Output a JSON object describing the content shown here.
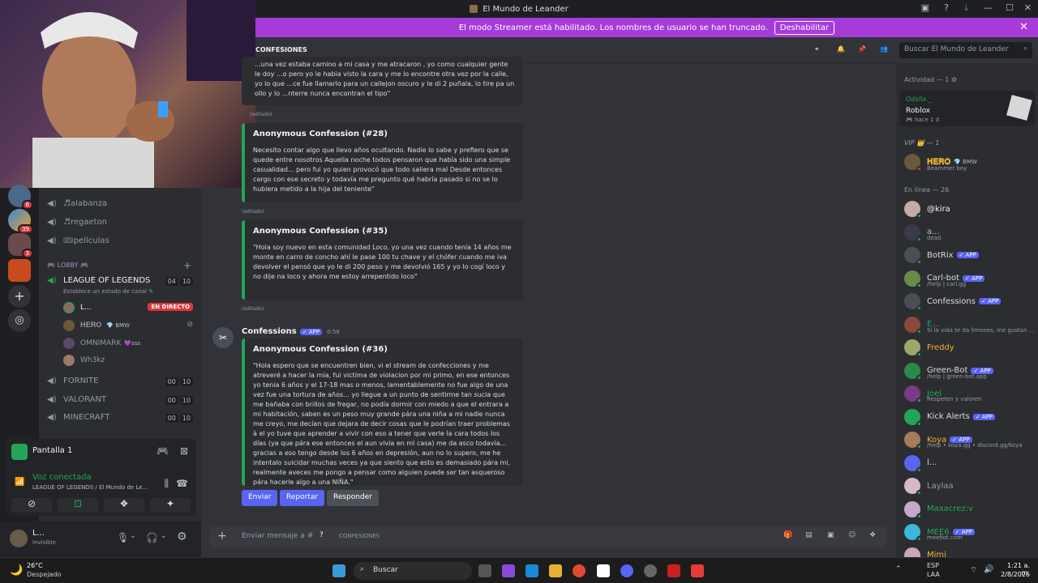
{
  "window": {
    "title": "El Mundo de Leander"
  },
  "banner": {
    "text": "El modo Streamer está habilitado. Los nombres de usuario se han truncado.",
    "button": "Deshabilitar"
  },
  "header": {
    "channel": "CONFESIONES",
    "search_placeholder": "Buscar El Mundo de Leander"
  },
  "channels": {
    "voice": [
      {
        "name": "♬alabanza"
      },
      {
        "name": "♬regaeton"
      },
      {
        "name": "🎟peliculas"
      }
    ],
    "category": "LOBBY",
    "lol": {
      "name": "LEAGUE OF LEGENDS",
      "status": "Establece un estado de canal",
      "count_a": "04",
      "count_b": "10"
    },
    "voice_users": [
      {
        "name": "L...",
        "live": "EN DIRECTO"
      },
      {
        "name": "𝐇𝐄𝐑𝐎",
        "tag": "BMW"
      },
      {
        "name": "OMNIMARK",
        "tag": "ꜱꜱꜱ"
      },
      {
        "name": "Wh3kz"
      }
    ],
    "others": [
      {
        "name": "FORNITE",
        "a": "00",
        "b": "10"
      },
      {
        "name": "VALORANT",
        "a": "00",
        "b": "10"
      },
      {
        "name": "MINECRAFT",
        "a": "00",
        "b": "10"
      }
    ]
  },
  "voice_panel": {
    "screen": "Pantalla 1",
    "status": "Voz conectada",
    "location": "LEAGUE OF LEGENDS / El Mundo de Le..."
  },
  "user_panel": {
    "name": "L...",
    "status": "Invisible"
  },
  "messages": {
    "top_embed_text": "...una vez estaba camino a mi casa y me atracaron , yo como cualquier gente le doy ...o pero yo le habia visto la cara y me lo encontre otra vez por la calle, yo lo que ...ce fue llamarlo para un callejon oscuro y le di 2 puñala, lo tire pa un ollo y lo ...nterre nunca encontran el tipo\"",
    "edit_label": "(editado)",
    "c28_title": "Anonymous Confession (#28)",
    "c28_text": "Necesito contar algo que llevo años ocultando. Nadie lo sabe y prefiero que se quede entre nosotros Aquella noche todos pensaron que había sido una simple casualidad... pero fui yo quien provocó que todo saliera mal Desde entonces cargo con ese secreto y todavía me pregunto qué habría pasado si no se lo hubiera metido a la hija del teniente\"",
    "c35_title": "Anonymous Confession (#35)",
    "c35_text": "\"Hola soy nuevo en esta comunidad Loco, yo una vez cuando tenía 14 años me monte en carro de concho ahí le pase 100 tu chave y el chófer cuando me iva devolver el pensó que yo le di 200 peso y me devolvió 165 y yo lo cogí loco y no dije na loco y ahora me estoy arrepentido loco\"",
    "author": "Confessions",
    "app_badge": "✓ APP",
    "time": "0:58",
    "c36_title": "Anonymous Confession (#36)",
    "c36_text": "\"Hola espero que se encuentren bien, vi el stream de confecciones y me atreveré a hacer la mia, fui victima de violacion por mi primo, en ese entonces yo tenia 6 años y el 17-18 mas o menos, lamentablemente no fue algo de una vez fue una tortura de años... yo llegue a un punto de sentirme tan sucia que me bañaba con brillos de fregar, no podía dormir con miedo a que el entrara a mi habitación, saben es un peso muy grande pára una niña a mi nadie nunca me creyo, me decían que dejara de decir cosas que le podrían traer problemas à el yo tuve que aprender a vivir con eso a tener que verle la cara todos los días (ya que pára ese entonces el aun vivia en mi casa) me da asco todavía... gracias a eso tengo desde los 6 años en depresión, aun no lo supero, me he intentalo suicidar muchas veces ya que siento que esto es demasiado pára mi, realmente aveces me pongo a pensar como alguien puede ser tan asqueroso pára hacerle algo a una NIÑA.\"",
    "actions": [
      "Enviar",
      "Reportar",
      "Responder"
    ]
  },
  "composer": {
    "placeholder": "Enviar mensaje a #",
    "channel": "CONFESIONES"
  },
  "members": {
    "activity_header": "Actividad — 1",
    "activity": {
      "user": "Odxlix._",
      "game": "Roblox",
      "time": "hace 1 d"
    },
    "vip_header": "VIP 👑 — 1",
    "vip": {
      "name": "𝐇𝐄𝐑𝐎",
      "tag": "BMW",
      "sub": "Beammer boy"
    },
    "online_header": "En línea — 26",
    "list": [
      {
        "name": "@kira",
        "sub": ""
      },
      {
        "name": "a...",
        "sub": "dead"
      },
      {
        "name": "BotRix",
        "app": "✓ APP",
        "sub": ""
      },
      {
        "name": "Carl-bot",
        "app": "✓ APP",
        "sub": "/help | carl.gg"
      },
      {
        "name": "Confessions",
        "app": "✓ APP",
        "sub": ""
      },
      {
        "name": "E...",
        "sub": "Si la vida te da limones, me gustan ..."
      },
      {
        "name": "Freddy",
        "sub": ""
      },
      {
        "name": "Green-Bot",
        "app": "✓ APP",
        "sub": "/help | green-bot.app"
      },
      {
        "name": "Joel",
        "sub": "Respeten y valoren"
      },
      {
        "name": "Kick Alerts",
        "app": "✓ APP",
        "sub": ""
      },
      {
        "name": "Koya",
        "app": "✓ APP",
        "sub": "/help • koya.gg • discord.gg/koya"
      },
      {
        "name": "l...",
        "sub": ""
      },
      {
        "name": "Laylaa",
        "sub": ""
      },
      {
        "name": "Maxacrez:v",
        "sub": ""
      },
      {
        "name": "MEE6",
        "app": "✓ APP",
        "sub": "meeбot.com"
      },
      {
        "name": "Mimi",
        "sub": ""
      }
    ]
  },
  "taskbar": {
    "temp": "26°C",
    "weather": "Despejado",
    "search": "Buscar",
    "lang1": "ESP",
    "lang2": "LAA",
    "time": "1:21 a. m.",
    "date": "2/8/2026"
  },
  "colors": {
    "accent": "#5865f2",
    "banner": "#a63bd9",
    "online": "#23a559",
    "live": "#da373c"
  }
}
